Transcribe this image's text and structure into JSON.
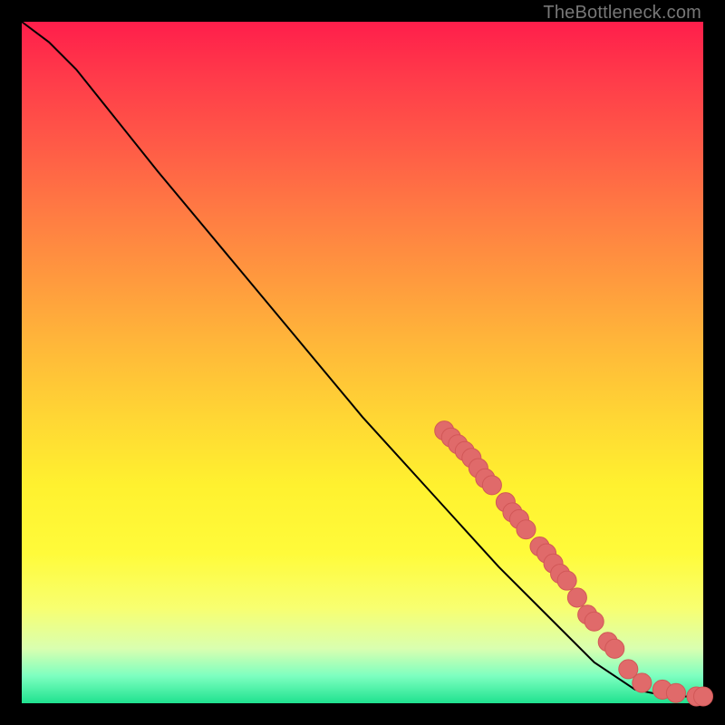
{
  "attribution": "TheBottleneck.com",
  "colors": {
    "marker_fill": "#e06a6a",
    "marker_stroke": "#d15757",
    "curve": "#000000",
    "gradient_top": "#ff1e4b",
    "gradient_mid": "#fff12f",
    "gradient_bottom": "#1fe28f",
    "page_bg": "#000000"
  },
  "chart_data": {
    "type": "line",
    "title": "",
    "xlabel": "",
    "ylabel": "",
    "xlim": [
      0,
      100
    ],
    "ylim": [
      0,
      100
    ],
    "grid": false,
    "legend": false,
    "curve": [
      {
        "x": 0,
        "y": 100
      },
      {
        "x": 4,
        "y": 97
      },
      {
        "x": 8,
        "y": 93
      },
      {
        "x": 12,
        "y": 88
      },
      {
        "x": 20,
        "y": 78
      },
      {
        "x": 30,
        "y": 66
      },
      {
        "x": 40,
        "y": 54
      },
      {
        "x": 50,
        "y": 42
      },
      {
        "x": 60,
        "y": 31
      },
      {
        "x": 70,
        "y": 20
      },
      {
        "x": 78,
        "y": 12
      },
      {
        "x": 84,
        "y": 6
      },
      {
        "x": 90,
        "y": 2
      },
      {
        "x": 95,
        "y": 1
      },
      {
        "x": 100,
        "y": 1
      }
    ],
    "markers": [
      {
        "x": 62,
        "y": 40
      },
      {
        "x": 63,
        "y": 39
      },
      {
        "x": 64,
        "y": 38
      },
      {
        "x": 65,
        "y": 37
      },
      {
        "x": 66,
        "y": 36
      },
      {
        "x": 67,
        "y": 34.5
      },
      {
        "x": 68,
        "y": 33
      },
      {
        "x": 69,
        "y": 32
      },
      {
        "x": 71,
        "y": 29.5
      },
      {
        "x": 72,
        "y": 28
      },
      {
        "x": 73,
        "y": 27
      },
      {
        "x": 74,
        "y": 25.5
      },
      {
        "x": 76,
        "y": 23
      },
      {
        "x": 77,
        "y": 22
      },
      {
        "x": 78,
        "y": 20.5
      },
      {
        "x": 79,
        "y": 19
      },
      {
        "x": 80,
        "y": 18
      },
      {
        "x": 81.5,
        "y": 15.5
      },
      {
        "x": 83,
        "y": 13
      },
      {
        "x": 84,
        "y": 12
      },
      {
        "x": 86,
        "y": 9
      },
      {
        "x": 87,
        "y": 8
      },
      {
        "x": 89,
        "y": 5
      },
      {
        "x": 91,
        "y": 3
      },
      {
        "x": 94,
        "y": 2
      },
      {
        "x": 96,
        "y": 1.5
      },
      {
        "x": 99,
        "y": 1
      },
      {
        "x": 100,
        "y": 1
      }
    ]
  }
}
